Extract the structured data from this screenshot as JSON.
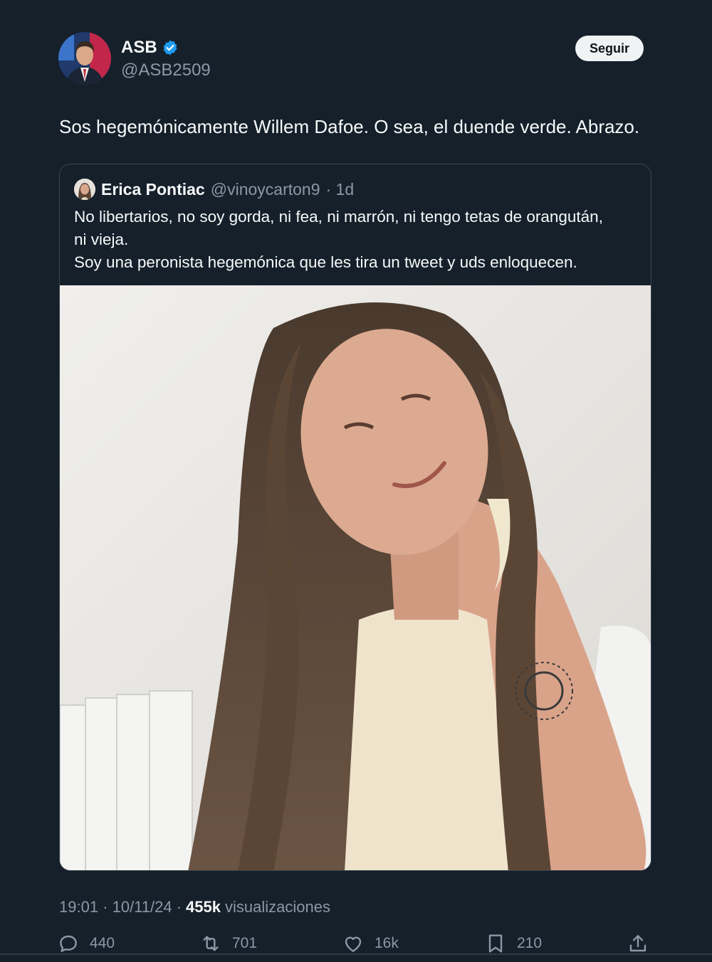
{
  "header": {
    "display_name": "ASB",
    "handle": "@ASB2509",
    "follow_label": "Seguir",
    "verified_icon": "verified-badge-icon",
    "verified_color": "#1d9bf0"
  },
  "tweet": {
    "text": "Sos hegemónicamente Willem Dafoe. O sea, el duende verde. Abrazo."
  },
  "quote": {
    "display_name": "Erica Pontiac",
    "handle": "@vinoycarton9",
    "time": "· 1d",
    "lines": [
      "No libertarios, no soy gorda, ni fea, ni marrón, ni tengo tetas de orangután,",
      "ni vieja.",
      "Soy una peronista hegemónica que les tira un tweet y uds enloquecen."
    ]
  },
  "meta": {
    "timestamp": "19:01 · 10/11/24 ·",
    "views_count": "455k",
    "views_label": "visualizaciones"
  },
  "actions": {
    "replies": "440",
    "retweets": "701",
    "likes": "16k",
    "bookmarks": "210"
  },
  "colors": {
    "background": "#15202b",
    "text": "#f7f9f9",
    "muted": "#8b98a5",
    "border": "#38444d"
  }
}
